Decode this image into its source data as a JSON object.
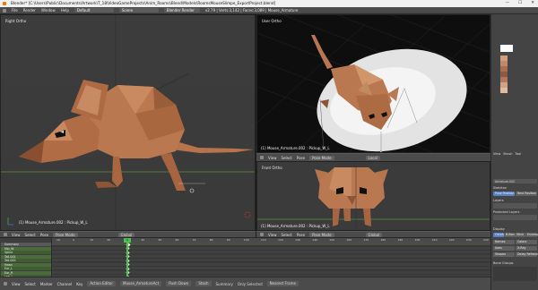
{
  "window": {
    "title": "Blender* [C:\\Users\\Public\\Documents\\Artwork\\T_18\\VideoGameProjects\\Anim_Rooms\\Blend\\Models\\RoomsMouseSlimpe_ExportProject.blend]",
    "controls": [
      "—",
      "☐",
      "✕"
    ]
  },
  "info_header": {
    "menus": [
      "File",
      "Render",
      "Window",
      "Help"
    ],
    "layout": "Default",
    "scene": "Scene",
    "engine": "Blender Render",
    "stats": "v2.79 | Verts:3,142 | Faces:3,089 | Mouse_Armature"
  },
  "viewports": {
    "right": {
      "label": "Right Ortho",
      "object": "(1) Mouse_Armature.002 : Pickup_W_L"
    },
    "user": {
      "label": "User Ortho",
      "object": "(1) Mouse_Armature.002 : Pickup_W_L"
    },
    "front": {
      "label": "Front Ortho",
      "object": "(1) Mouse_Armature.002 : Pickup_W_L"
    }
  },
  "view_header": {
    "menus": [
      "View",
      "Select",
      "Pose"
    ],
    "mode": "Pose Mode",
    "pivot": "Global",
    "transform": "Local"
  },
  "props_panel": {
    "tabs": [
      "View",
      "Brush",
      "Tool"
    ],
    "sections": [
      "Armature.002",
      "Skeleton",
      "Layers",
      "Protected Layers",
      "Display",
      "Bone Groups"
    ],
    "buttons": [
      "Pose Position",
      "Rest Position",
      "Octahedral",
      "B-Bone",
      "Stick",
      "Envelope",
      "Wire",
      "Names",
      "Axes",
      "Shapes",
      "Colors",
      "X-Ray",
      "Delay Refresh"
    ],
    "palette": [
      "#ffffff",
      "#d0a07a",
      "#c08a6a",
      "#a86e52",
      "#8a5a45",
      "#b07860",
      "#cfa47e",
      "#e3bca0"
    ]
  },
  "dopesheet": {
    "channels": [
      "Summary",
      "Hip_W",
      "Spine",
      "Tail.001",
      "Tail.002",
      "Head",
      "Ear_L",
      "Ear_R",
      "Leg_L"
    ],
    "ruler": [
      "-10",
      "0",
      "10",
      "20",
      "30",
      "40",
      "50",
      "60",
      "70",
      "80",
      "90",
      "100",
      "110",
      "120",
      "130",
      "140",
      "150",
      "160",
      "170",
      "180",
      "190",
      "200",
      "210",
      "220",
      "230",
      "240"
    ],
    "current_frame": "0"
  },
  "bottom_bar": {
    "menus": [
      "View",
      "Select",
      "Marker",
      "Channel",
      "Key"
    ],
    "editor": "Action Editor",
    "action": "Mouse_ArmatureAct",
    "push_down": "Push Down",
    "stash": "Stash",
    "summary": "Summary",
    "only_selected": "Only Selected",
    "interp": "Nearest Frame",
    "start_label": "Start:",
    "start": "1",
    "end_label": "End:",
    "end": "250",
    "frame": "0",
    "sync": "No Sync"
  },
  "colors": {
    "mouse_body": "#b8774e",
    "mouse_dark": "#8d5535",
    "accent_green": "#4ec24e",
    "highlight_blue": "#5680c2"
  }
}
